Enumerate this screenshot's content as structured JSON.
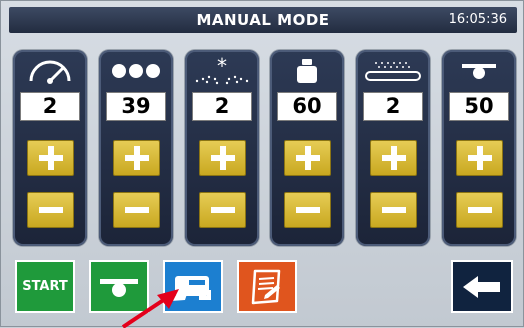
{
  "header": {
    "title": "MANUAL MODE",
    "time": "16:05:36"
  },
  "panels": [
    {
      "icon": "speed-gauge-icon",
      "value": "2"
    },
    {
      "icon": "dots-icon",
      "value": "39"
    },
    {
      "icon": "spray-icon",
      "value": "2"
    },
    {
      "icon": "weight-icon",
      "value": "60"
    },
    {
      "icon": "conveyor-icon",
      "value": "2"
    },
    {
      "icon": "press-height-icon",
      "value": "50"
    }
  ],
  "bottom": {
    "start_label": "START",
    "press_icon": "press-icon",
    "printer_icon": "printer-icon",
    "report_icon": "report-icon",
    "back_icon": "back-arrow-icon"
  },
  "colors": {
    "header_bg": "#222c40",
    "panel_bg": "#1c2438",
    "adjust_button": "#d4b533",
    "start_green": "#1f9a3b",
    "printer_blue": "#1c7fd0",
    "report_orange": "#e0551e",
    "back_navy": "#10233f",
    "annotation_red": "#e4001b"
  }
}
